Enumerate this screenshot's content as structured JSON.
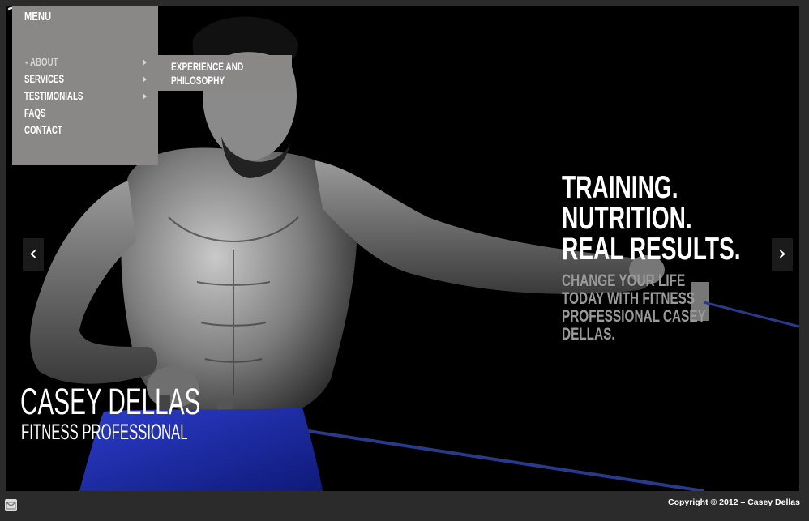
{
  "menu": {
    "title": "MENU",
    "items": [
      {
        "label": "ABOUT",
        "has_submenu": true,
        "active": true
      },
      {
        "label": "SERVICES",
        "has_submenu": true,
        "active": false
      },
      {
        "label": "TESTIMONIALS",
        "has_submenu": true,
        "active": false
      },
      {
        "label": "FAQS",
        "has_submenu": false,
        "active": false
      },
      {
        "label": "CONTACT",
        "has_submenu": false,
        "active": false
      }
    ],
    "submenu": {
      "label": "EXPERIENCE AND PHILOSOPHY"
    }
  },
  "hero": {
    "headline": [
      "TRAINING.",
      "NUTRITION.",
      "REAL RESULTS."
    ],
    "subheadline": "CHANGE YOUR LIFE TODAY WITH FITNESS PROFESSIONAL CASEY DELLAS.",
    "name": "CASEY DELLAS",
    "title": "FITNESS PROFESSIONAL",
    "prev_label": "‹",
    "next_label": "›"
  },
  "footer": {
    "copyright": "Copyright © 2012 – Casey Dellas"
  },
  "colors": {
    "menu_bg": "#8a8887",
    "page_bg": "#2b2b2b",
    "hero_bg": "#000000",
    "accent_shorts": "#1d2fb0"
  }
}
